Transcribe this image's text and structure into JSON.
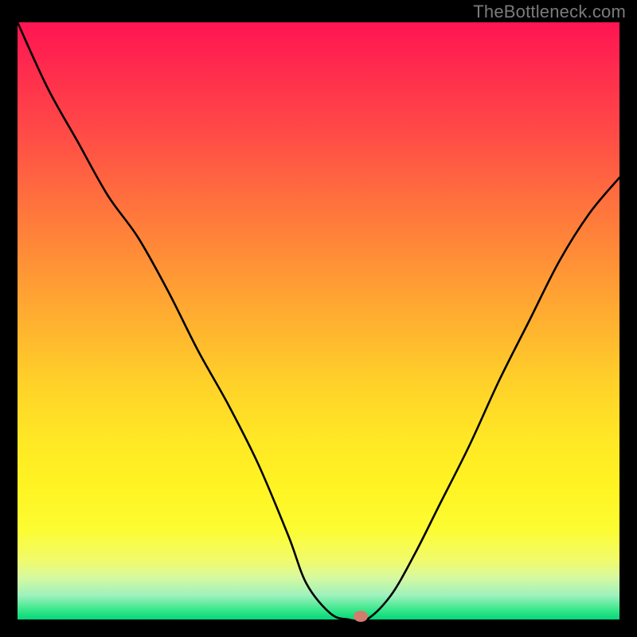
{
  "attribution": "TheBottleneck.com",
  "chart_data": {
    "type": "line",
    "title": "",
    "xlabel": "",
    "ylabel": "",
    "xrange": [
      0,
      100
    ],
    "yrange": [
      0,
      100
    ],
    "series": [
      {
        "name": "bottleneck-curve",
        "x": [
          0,
          5,
          10,
          15,
          20,
          25,
          30,
          35,
          40,
          45,
          48,
          52,
          55,
          58,
          62,
          66,
          70,
          75,
          80,
          85,
          90,
          95,
          100
        ],
        "y": [
          100,
          89,
          80,
          71,
          64,
          55,
          45,
          36,
          26,
          14,
          6,
          1,
          0,
          0,
          4,
          11,
          19,
          29,
          40,
          50,
          60,
          68,
          74
        ]
      }
    ],
    "marker": {
      "x": 57,
      "y": 0.5
    },
    "gradient": {
      "top_color": "#ff1453",
      "mid_color": "#ffd029",
      "bottom_color": "#06d57b"
    }
  }
}
